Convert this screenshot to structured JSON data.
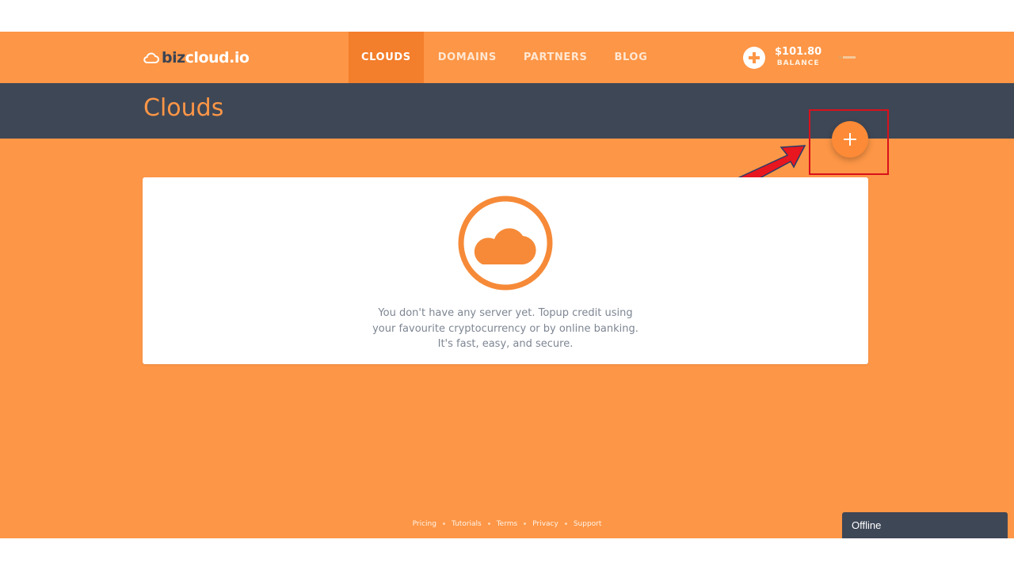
{
  "brand": {
    "part1": "biz",
    "part2": "cloud.io"
  },
  "nav": {
    "items": [
      {
        "label": "CLOUDS",
        "active": true
      },
      {
        "label": "DOMAINS",
        "active": false
      },
      {
        "label": "PARTNERS",
        "active": false
      },
      {
        "label": "BLOG",
        "active": false
      }
    ]
  },
  "account": {
    "balance_amount": "$101.80",
    "balance_label": "BALANCE",
    "topup_icon": "plus-circle-icon",
    "avatar_icon": "user-avatar"
  },
  "page": {
    "title": "Clouds"
  },
  "add_button": {
    "icon": "plus-icon"
  },
  "empty_state": {
    "icon": "cloud-icon",
    "lines": [
      "You don't have any server yet. Topup credit using",
      "your favourite cryptocurrency or by online banking.",
      "It's fast, easy, and secure."
    ]
  },
  "footer": {
    "links": [
      "Pricing",
      "Tutorials",
      "Terms",
      "Privacy",
      "Support"
    ]
  },
  "chat": {
    "status": "Offline"
  },
  "colors": {
    "accent": "#FD9646",
    "accent_dark": "#F37E2B",
    "header": "#3E4756",
    "annotation": "#D9101C"
  }
}
